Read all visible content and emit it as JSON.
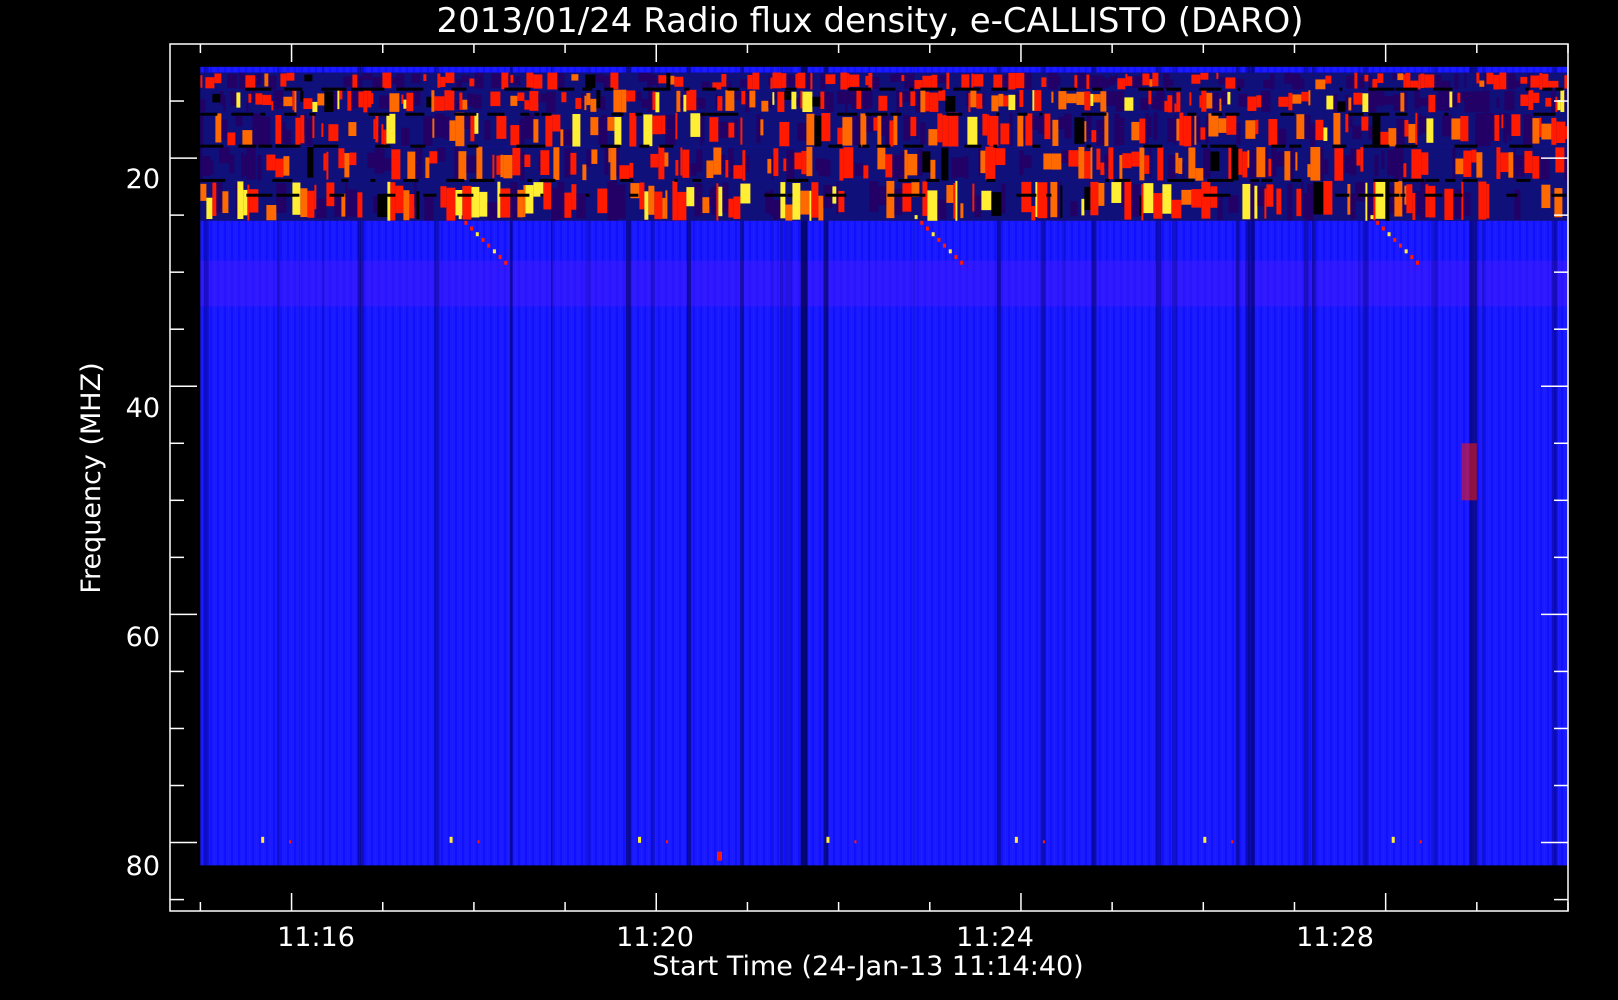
{
  "chart_data": {
    "type": "heatmap",
    "title": "2013/01/24  Radio flux density, e-CALLISTO (DARO)",
    "xlabel": "Start Time (24-Jan-13 11:14:40)",
    "ylabel": "Frequency (MHZ)",
    "x_ticks": [
      "11:16",
      "11:20",
      "11:24",
      "11:28"
    ],
    "y_ticks": [
      "20",
      "40",
      "60",
      "80"
    ],
    "x_range": [
      "11:14:40",
      "11:30:00"
    ],
    "data_time_range": [
      "11:15:00",
      "11:30:00"
    ],
    "y_range_mhz": [
      10,
      86
    ],
    "data_freq_range_mhz": [
      12,
      82
    ],
    "y_axis_inverted": true,
    "colormap": {
      "low": "#000000",
      "background": "#1a1aff",
      "mid": "#ff1a00",
      "high": "#ffee33"
    },
    "features": [
      {
        "name": "band 12.5-14 MHz",
        "freq_mhz": [
          12.5,
          14
        ],
        "intensity": 0.3
      },
      {
        "name": "band 14-16 MHz",
        "freq_mhz": [
          14,
          16
        ],
        "intensity": 0.65
      },
      {
        "name": "band 16-19 MHz",
        "freq_mhz": [
          16,
          19
        ],
        "intensity": 0.55
      },
      {
        "name": "band 19-22 MHz",
        "freq_mhz": [
          19,
          22
        ],
        "intensity": 0.5
      },
      {
        "name": "band 22-25.5 MHz",
        "freq_mhz": [
          22,
          25.5
        ],
        "intensity": 0.75
      },
      {
        "name": "drift burst 1",
        "time": [
          "11:17:50",
          "11:18:20"
        ],
        "freq_mhz": [
          25,
          29
        ],
        "intensity": 0.9
      },
      {
        "name": "drift burst 2",
        "time": [
          "11:22:50",
          "11:23:20"
        ],
        "freq_mhz": [
          25,
          29
        ],
        "intensity": 0.9
      },
      {
        "name": "drift burst 3",
        "time": [
          "11:27:50",
          "11:28:20"
        ],
        "freq_mhz": [
          25,
          29
        ],
        "intensity": 0.9
      },
      {
        "name": "spot near 48 MHz",
        "time": [
          "11:28:50",
          "11:29:00"
        ],
        "freq_mhz": [
          45,
          50
        ],
        "intensity": 0.7
      }
    ]
  }
}
